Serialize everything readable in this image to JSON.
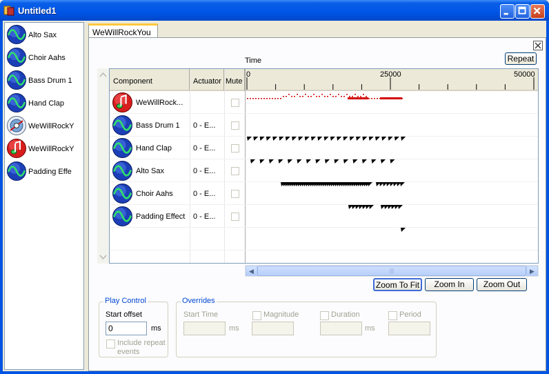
{
  "window": {
    "title": "Untitled1"
  },
  "left_panel": {
    "items": [
      {
        "label": "Alto Sax",
        "icon": "wave-icon"
      },
      {
        "label": "Choir Aahs",
        "icon": "wave-icon"
      },
      {
        "label": "Bass Drum 1",
        "icon": "wave-icon"
      },
      {
        "label": "Hand Clap",
        "icon": "wave-icon"
      },
      {
        "label": "WeWillRockY",
        "icon": "compound-effect-icon"
      },
      {
        "label": "WeWillRockY",
        "icon": "music-note-icon"
      },
      {
        "label": "Padding Effe",
        "icon": "wave-icon"
      }
    ]
  },
  "tab": {
    "label": "WeWillRockYou"
  },
  "timeline": {
    "repeat_label": "Repeat",
    "time_label": "Time",
    "ticks": [
      "0",
      "25000",
      "50000"
    ],
    "columns": {
      "component": "Component",
      "actuator": "Actuator",
      "mute": "Mute"
    },
    "rows": [
      {
        "name": "WeWillRock...",
        "actuator": "",
        "icon": "music-note-icon"
      },
      {
        "name": "Bass Drum 1",
        "actuator": "0 - E...",
        "icon": "wave-icon"
      },
      {
        "name": "Hand Clap",
        "actuator": "0 - E...",
        "icon": "wave-icon"
      },
      {
        "name": "Alto Sax",
        "actuator": "0 - E...",
        "icon": "wave-icon"
      },
      {
        "name": "Choir Aahs",
        "actuator": "0 - E...",
        "icon": "wave-icon"
      },
      {
        "name": "Padding Effect",
        "actuator": "0 - E...",
        "icon": "wave-icon"
      }
    ]
  },
  "zoom": {
    "fit": "Zoom To Fit",
    "in": "Zoom In",
    "out": "Zoom Out"
  },
  "play_control": {
    "title": "Play Control",
    "start_offset_label": "Start offset",
    "start_offset_value": "0",
    "unit": "ms",
    "include_repeat": "Include repeat events"
  },
  "overrides": {
    "title": "Overrides",
    "start_time": "Start Time",
    "magnitude": "Magnitude",
    "duration": "Duration",
    "period": "Period",
    "unit": "ms"
  },
  "colors": {
    "accent": "#0054e3",
    "tab_highlight": "#ffc83c",
    "event_red": "#d40000"
  }
}
